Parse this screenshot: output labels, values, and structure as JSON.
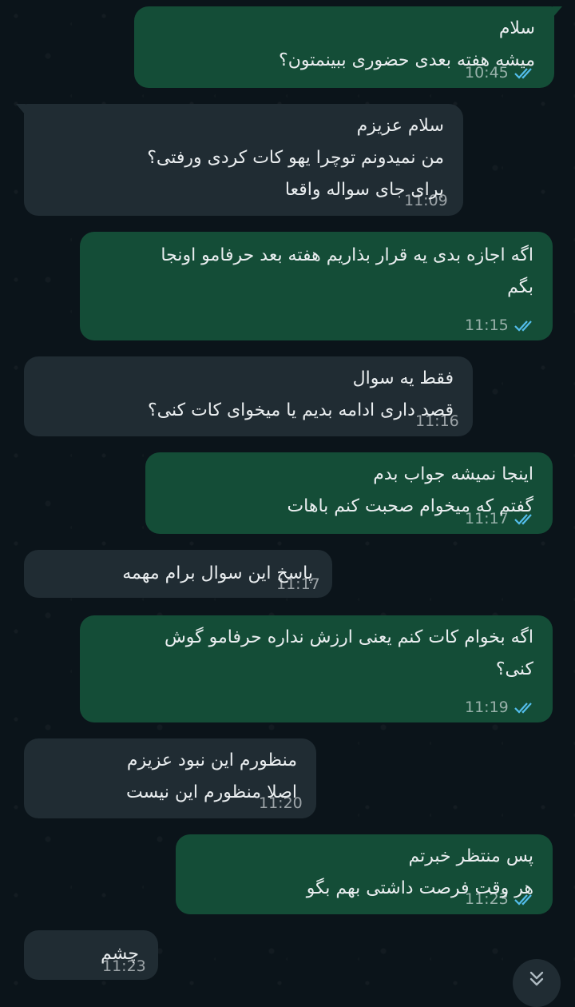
{
  "messages": [
    {
      "dir": "out",
      "lines": [
        "سلام",
        "میشه هفته بعدی حضوری ببینمتون؟"
      ],
      "time": "10:45",
      "read": true
    },
    {
      "dir": "in",
      "lines": [
        "سلام عزیزم",
        "من نمیدونم توچرا یهو کات کردی ورفتی؟",
        "برای جای سواله واقعا"
      ],
      "time": "11:09",
      "read": false
    },
    {
      "dir": "out",
      "lines": [
        "اگه اجازه بدی یه قرار بذاریم هفته بعد حرفامو اونجا",
        "بگم"
      ],
      "time": "11:15",
      "read": true
    },
    {
      "dir": "in",
      "lines": [
        "فقط یه سوال",
        "قصد داری ادامه بدیم یا میخوای کات کنی؟"
      ],
      "time": "11:16",
      "read": false
    },
    {
      "dir": "out",
      "lines": [
        "اینجا نمیشه جواب بدم",
        "گفتم که میخوام صحبت کنم باهات"
      ],
      "time": "11:17",
      "read": true
    },
    {
      "dir": "in",
      "lines": [
        "پاسخ این سوال برام مهمه"
      ],
      "time": "11:17",
      "read": false
    },
    {
      "dir": "out",
      "lines": [
        "اگه بخوام کات کنم یعنی ارزش نداره حرفامو گوش",
        "کنی؟"
      ],
      "time": "11:19",
      "read": true
    },
    {
      "dir": "in",
      "lines": [
        "منظورم این نبود عزیزم",
        "اصلا منظورم این نیست"
      ],
      "time": "11:20",
      "read": false
    },
    {
      "dir": "out",
      "lines": [
        "پس منتظر خبرتم",
        "هر وقت فرصت داشتی بهم بگو"
      ],
      "time": "11:23",
      "read": true
    },
    {
      "dir": "in",
      "lines": [
        "چشم"
      ],
      "time": "11:23",
      "read": false
    }
  ],
  "scroll_button": {
    "icon": "double-chevron-down-icon"
  },
  "colors": {
    "background": "#0b141a",
    "outgoing_bubble": "#144d37",
    "incoming_bubble": "#202c33",
    "text": "#e9edef",
    "read_tick": "#53bdeb"
  }
}
